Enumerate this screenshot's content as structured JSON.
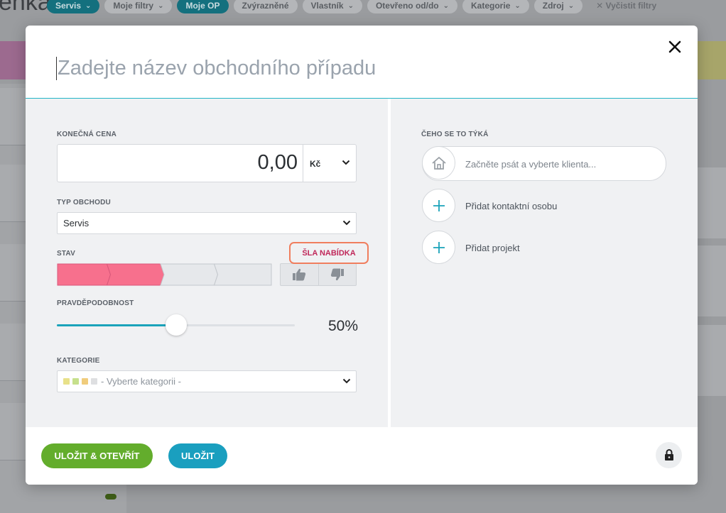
{
  "background": {
    "title_fragment": "enka",
    "filters": [
      {
        "label": "Servis",
        "style": "teal",
        "chevron": true
      },
      {
        "label": "Moje filtry",
        "style": "grey",
        "chevron": true
      },
      {
        "label": "Moje OP",
        "style": "teal",
        "chevron": false
      },
      {
        "label": "Zvýrazněné",
        "style": "grey",
        "chevron": false
      },
      {
        "label": "Vlastník",
        "style": "grey",
        "chevron": true
      },
      {
        "label": "Otevřeno od/do",
        "style": "grey",
        "chevron": true
      },
      {
        "label": "Kategorie",
        "style": "grey",
        "chevron": true
      },
      {
        "label": "Zdroj",
        "style": "grey",
        "chevron": true
      }
    ],
    "clear_filters": "✕ Vyčistit filtry"
  },
  "modal": {
    "title_placeholder": "Zadejte název obchodního případu",
    "left": {
      "price": {
        "label": "KONEČNÁ CENA",
        "value": "0,00",
        "currency": "Kč"
      },
      "deal_type": {
        "label": "TYP OBCHODU",
        "value": "Servis"
      },
      "stage": {
        "label": "STAV",
        "badge": "ŠLA NABÍDKA",
        "stages_total": 4,
        "stages_active": 2
      },
      "probability": {
        "label": "PRAVDĚPODOBNOST",
        "value_text": "50%",
        "fraction": 0.5
      },
      "category": {
        "label": "KATEGORIE",
        "value": "- Vyberte kategorii -",
        "swatch_colors": [
          "#e8e18a",
          "#c6e08c",
          "#f0cc7c",
          "#dedfe1"
        ]
      }
    },
    "right": {
      "section_label": "ČEHO SE TO TÝKÁ",
      "client_placeholder": "Začněte psát a vyberte klienta...",
      "add_contact": "Přidat kontaktní osobu",
      "add_project": "Přidat projekt"
    },
    "footer": {
      "save_open": "ULOŽIT & OTEVŘÍT",
      "save": "ULOŽIT"
    }
  },
  "colors": {
    "accent_teal": "#1aa3ba",
    "stage_active": "#f7708d",
    "badge_border": "#f07e5e",
    "save_open_green": "#63ad2c",
    "save_blue": "#1a9fbf"
  }
}
